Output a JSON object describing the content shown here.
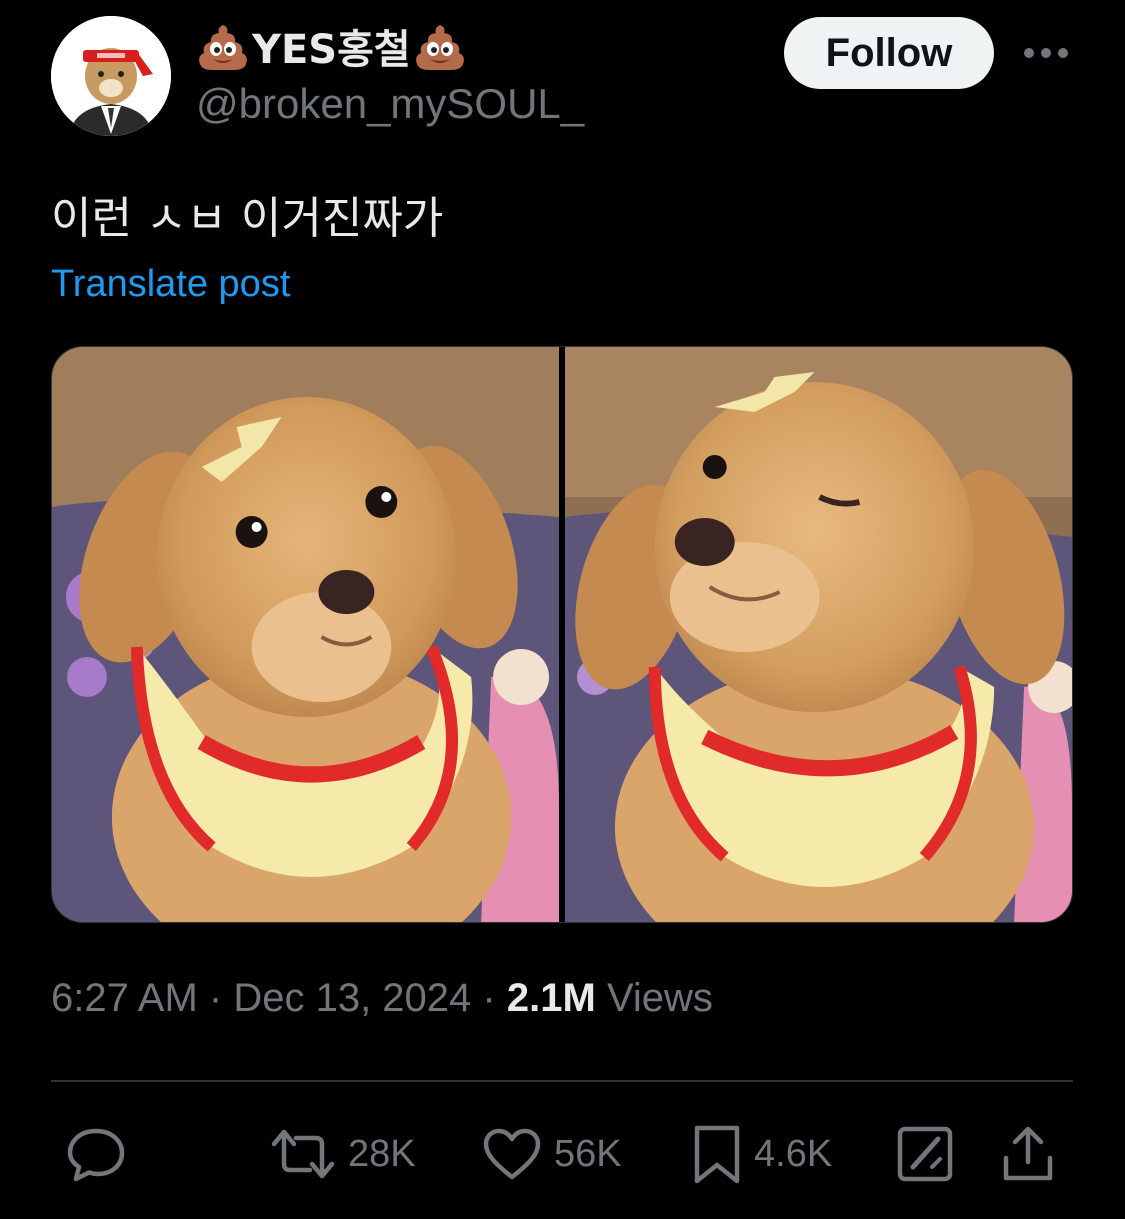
{
  "user": {
    "display_name": "YES홍철",
    "name_emoji_icon": "pile-of-poo-icon",
    "handle": "@broken_mySOUL_",
    "avatar_icon": "avatar-cat-headband-icon"
  },
  "header": {
    "follow_label": "Follow",
    "more_icon": "more-options-icon"
  },
  "post": {
    "text": "이런 ㅅㅂ 이거진짜가",
    "translate_label": "Translate post"
  },
  "media": {
    "photos": [
      {
        "subject": "puppy-looking-up-photo"
      },
      {
        "subject": "puppy-winking-photo"
      }
    ]
  },
  "meta": {
    "time": "6:27 AM",
    "separator": "·",
    "date": "Dec 13, 2024",
    "views_count": "2.1M",
    "views_label": "Views"
  },
  "actions": {
    "reply_icon": "reply-icon",
    "repost_count": "28K",
    "like_count": "56K",
    "bookmark_count": "4.6K",
    "grok_icon": "grok-icon",
    "share_icon": "share-icon"
  },
  "colors": {
    "background": "#000000",
    "text_primary": "#e7e9ea",
    "text_secondary": "#71767b",
    "link": "#1d9bf0",
    "divider": "#2f3336",
    "follow_bg": "#eff3f4"
  }
}
